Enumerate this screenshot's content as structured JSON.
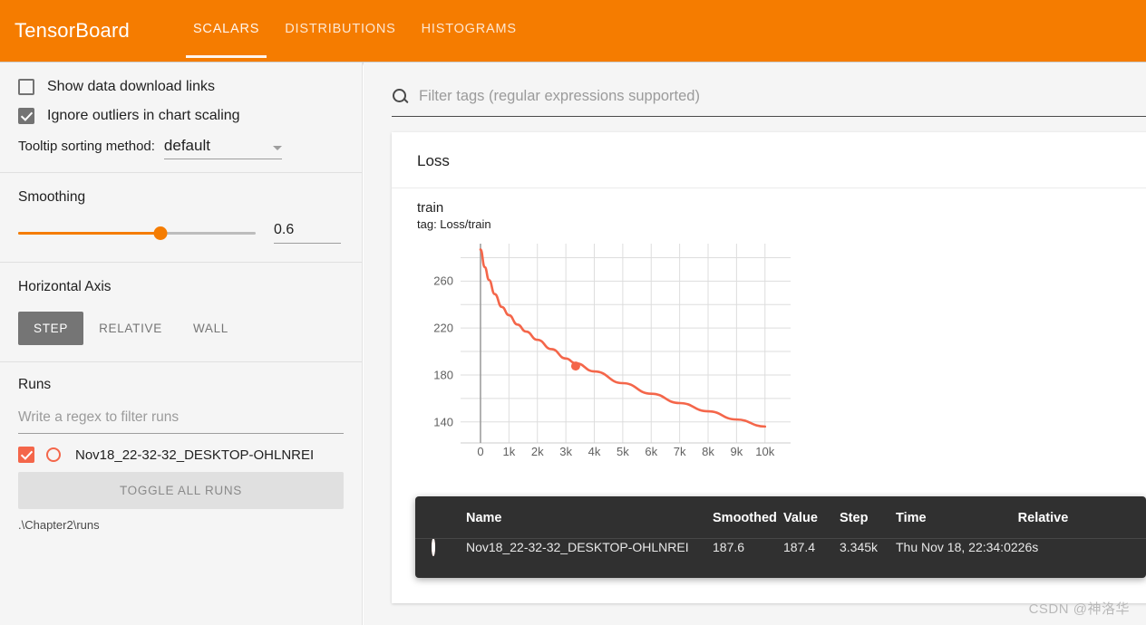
{
  "app": {
    "brand": "TensorBoard",
    "accent_color": "#f57c00",
    "series_color": "#f4664a"
  },
  "tabs": [
    {
      "label": "SCALARS",
      "active": true
    },
    {
      "label": "DISTRIBUTIONS",
      "active": false
    },
    {
      "label": "HISTOGRAMS",
      "active": false
    }
  ],
  "sidebar": {
    "show_download_links": {
      "label": "Show data download links",
      "checked": false
    },
    "ignore_outliers": {
      "label": "Ignore outliers in chart scaling",
      "checked": true
    },
    "tooltip_sorting": {
      "label": "Tooltip sorting method:",
      "value": "default"
    },
    "smoothing": {
      "heading": "Smoothing",
      "value": "0.6",
      "percent": 60
    },
    "horizontal_axis": {
      "heading": "Horizontal Axis",
      "options": [
        {
          "label": "STEP",
          "active": true
        },
        {
          "label": "RELATIVE",
          "active": false
        },
        {
          "label": "WALL",
          "active": false
        }
      ]
    },
    "runs": {
      "heading": "Runs",
      "filter_placeholder": "Write a regex to filter runs",
      "items": [
        {
          "name": "Nov18_22-32-32_DESKTOP-OHLNREI",
          "checked": true
        }
      ],
      "toggle_all_label": "TOGGLE ALL RUNS",
      "path": ".\\Chapter2\\runs"
    }
  },
  "main": {
    "filter_placeholder": "Filter tags (regular expressions supported)",
    "card_title": "Loss",
    "series_name": "train",
    "series_tag": "tag: Loss/train",
    "tools": [
      {
        "name": "expand-chart",
        "selected": false
      },
      {
        "name": "toggle-data-series",
        "selected": false
      },
      {
        "name": "fit-domain",
        "selected": true
      }
    ]
  },
  "chart_data": {
    "type": "line",
    "title": "Loss",
    "series_label": "train",
    "tag": "Loss/train",
    "xlabel": "",
    "ylabel": "",
    "xlim": [
      -700,
      10900
    ],
    "ylim": [
      122,
      292
    ],
    "grid": true,
    "legend": "none",
    "xticks": [
      0,
      1000,
      2000,
      3000,
      4000,
      5000,
      6000,
      7000,
      8000,
      9000,
      10000
    ],
    "xticklabels": [
      "0",
      "1k",
      "2k",
      "3k",
      "4k",
      "5k",
      "6k",
      "7k",
      "8k",
      "9k",
      "10k"
    ],
    "yticks": [
      140,
      180,
      220,
      260
    ],
    "yticklabels": [
      "140",
      "180",
      "220",
      "260"
    ],
    "series": [
      {
        "name": "Nov18_22-32-32_DESKTOP-OHLNREI",
        "color": "#f4664a",
        "x": [
          0,
          150,
          300,
          500,
          750,
          1000,
          1300,
          1600,
          2000,
          2500,
          3000,
          3345,
          4000,
          5000,
          6000,
          7000,
          8000,
          9000,
          10000
        ],
        "y": [
          287,
          272,
          261,
          249,
          238,
          231,
          223,
          217,
          210,
          202,
          194,
          190,
          183,
          173,
          164,
          156,
          149,
          142,
          136
        ]
      }
    ],
    "highlight_point": {
      "x": 3345,
      "y": 187.6
    }
  },
  "tooltip": {
    "columns": [
      "Name",
      "Smoothed",
      "Value",
      "Step",
      "Time",
      "Relative"
    ],
    "rows": [
      {
        "name": "Nov18_22-32-32_DESKTOP-OHLNREI",
        "smoothed": "187.6",
        "value": "187.4",
        "step": "3.345k",
        "time": "Thu Nov 18, 22:34:02",
        "relative": "26s"
      }
    ]
  },
  "watermark": "CSDN @神洛华"
}
